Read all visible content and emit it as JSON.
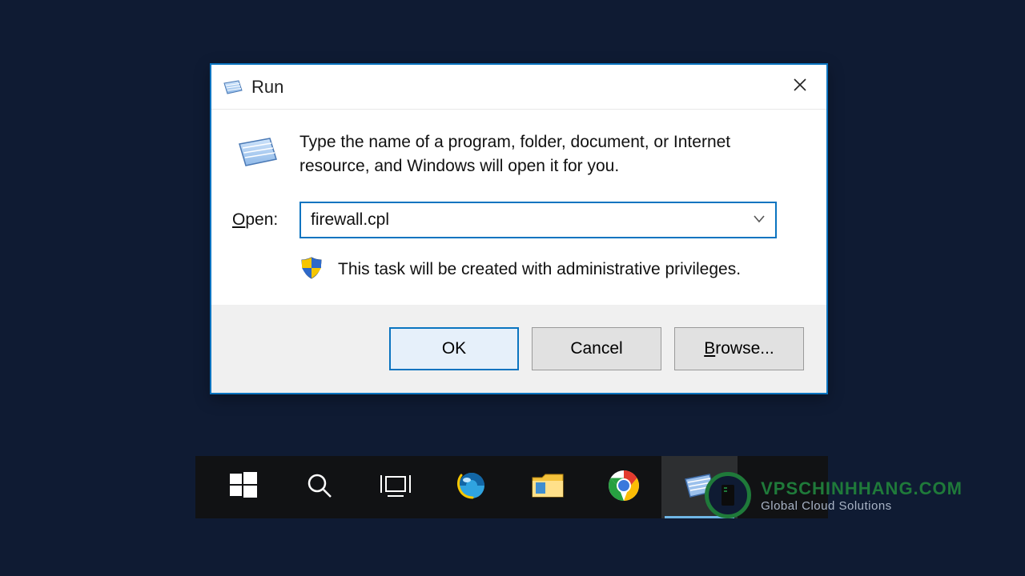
{
  "dialog": {
    "title": "Run",
    "instruction": "Type the name of a program, folder, document, or Internet resource, and Windows will open it for you.",
    "open_label_underline": "O",
    "open_label_rest": "pen:",
    "input_value": "firewall.cpl",
    "admin_message": "This task will be created with administrative privileges.",
    "buttons": {
      "ok": "OK",
      "cancel": "Cancel",
      "browse_underline": "B",
      "browse_rest": "rowse..."
    }
  },
  "watermark": {
    "brand": "VPSCHINHHANG.COM",
    "sub": "Global Cloud Solutions"
  }
}
